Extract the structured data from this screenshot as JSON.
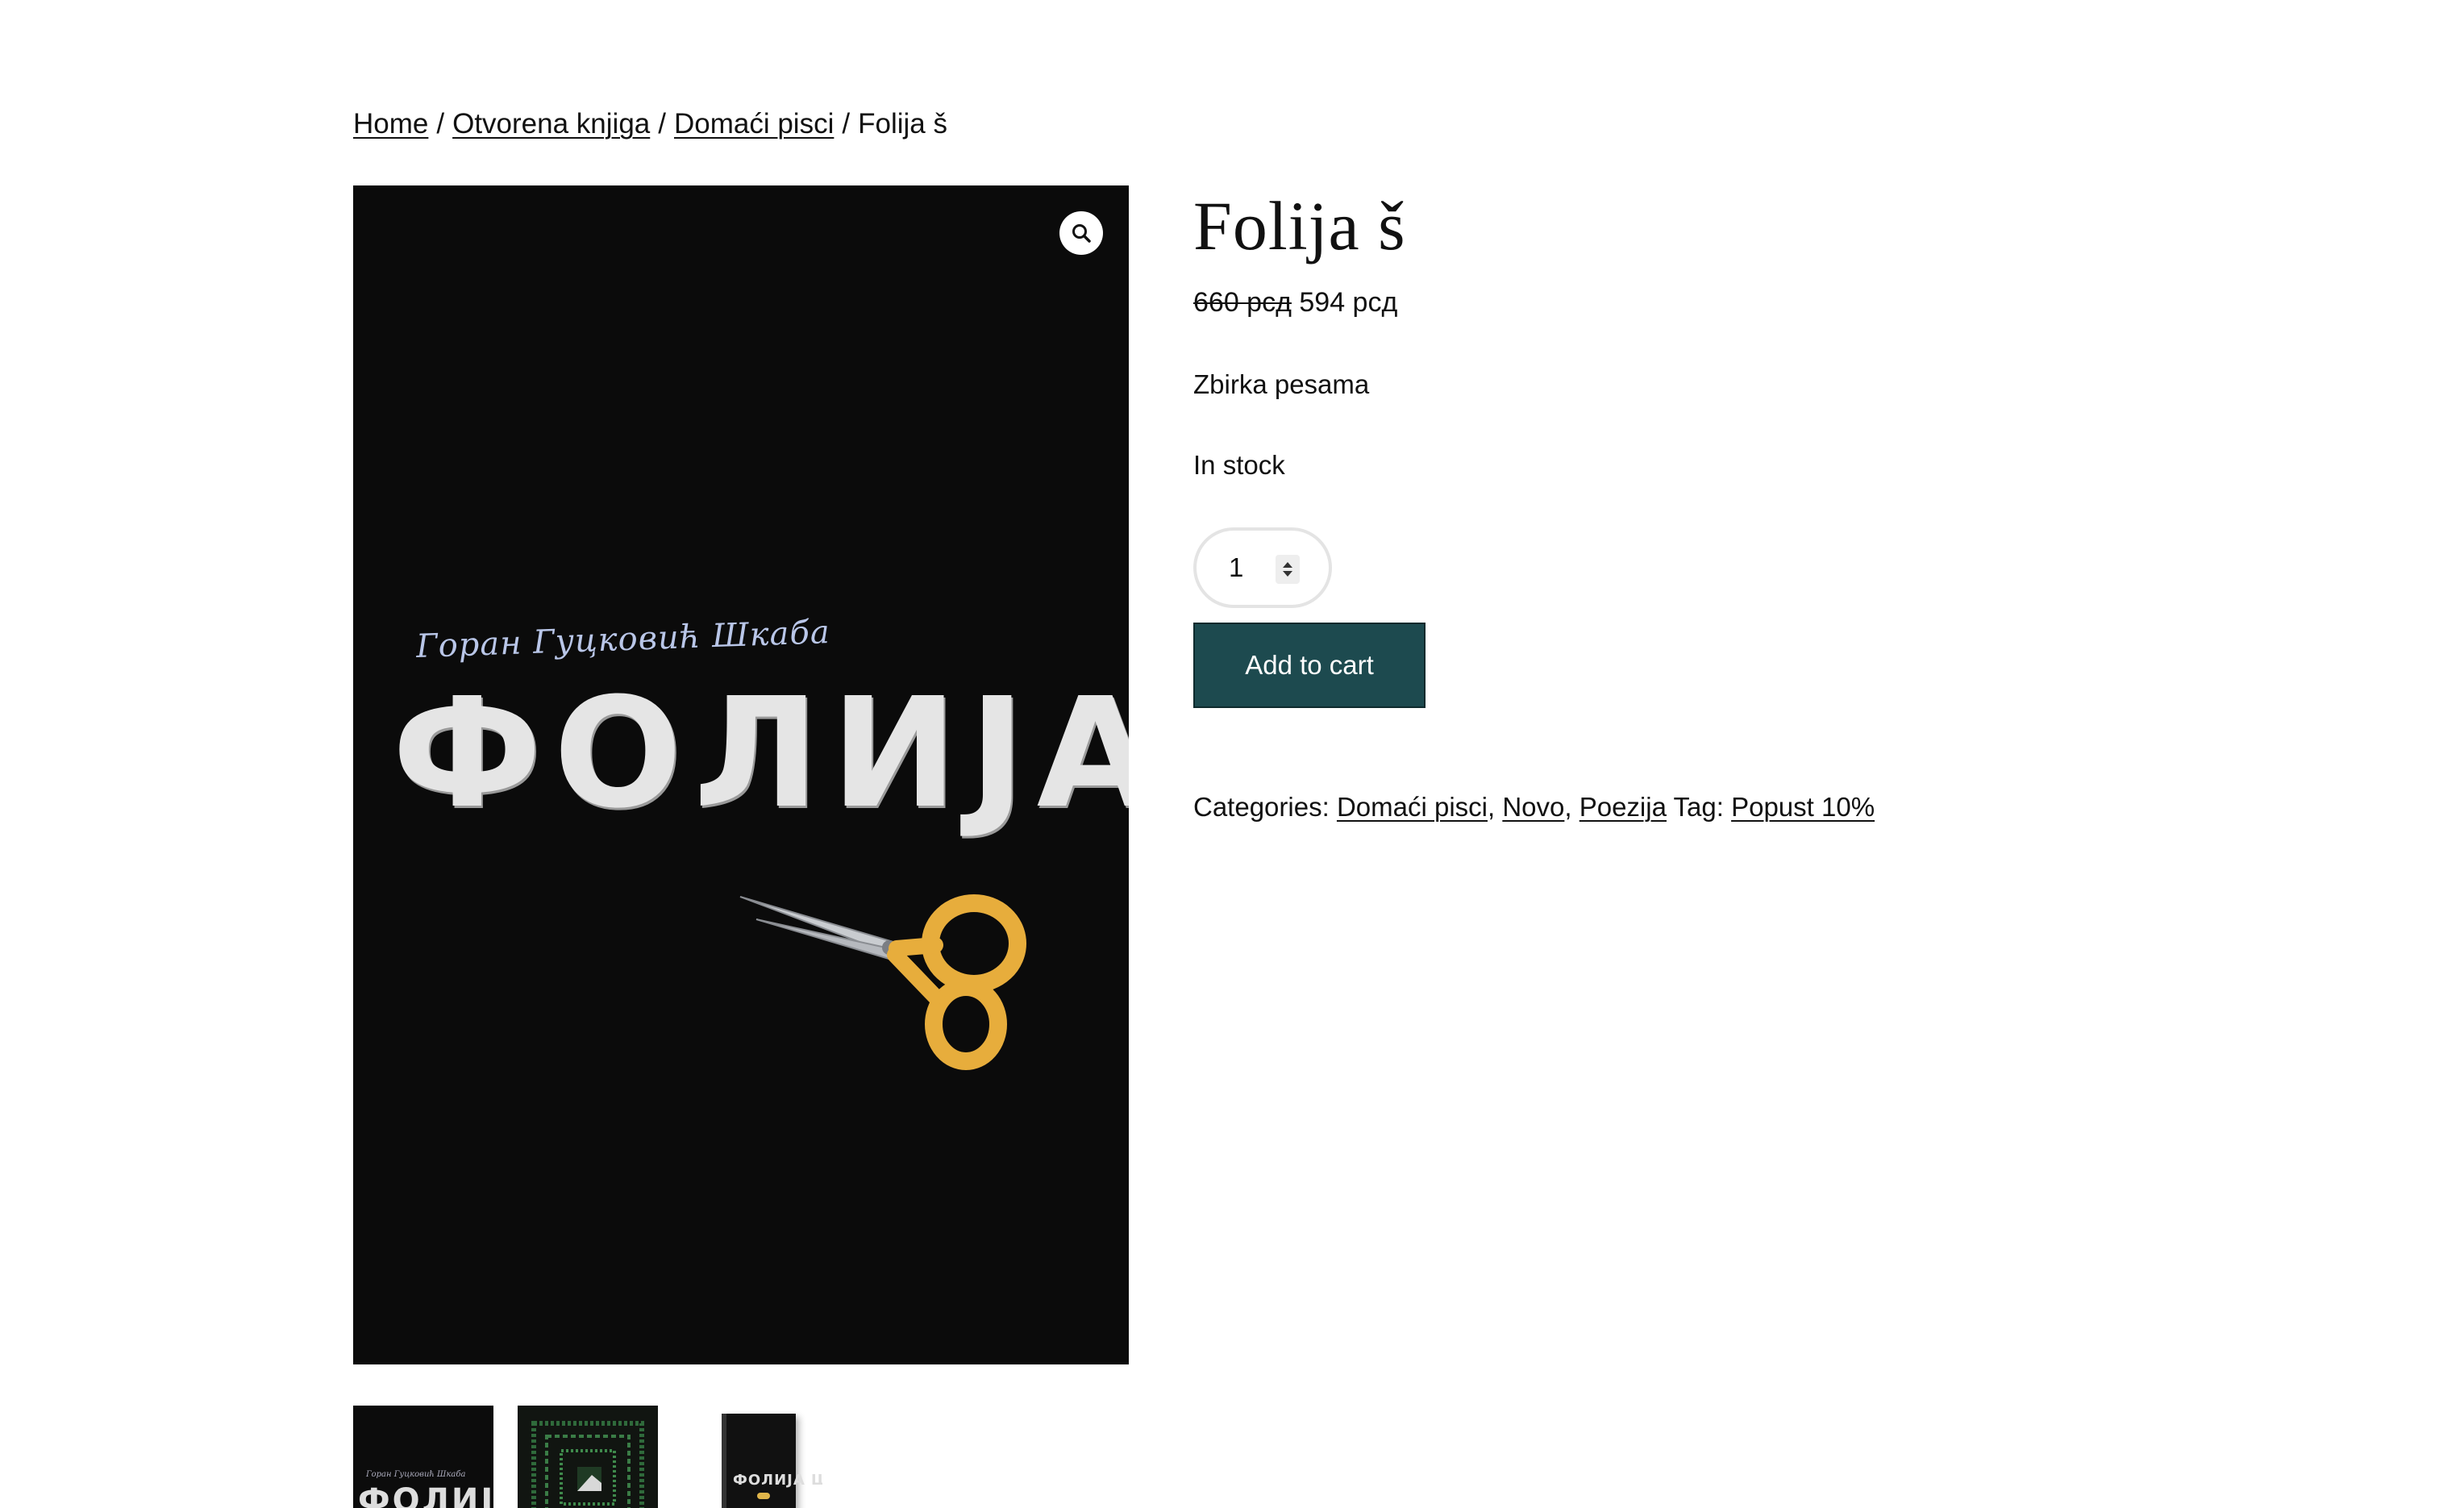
{
  "breadcrumb": {
    "items": [
      "Home",
      "Otvorena knjiga",
      "Domaći pisci"
    ],
    "separator": "/",
    "current": "Folija š"
  },
  "gallery": {
    "zoom_icon": "search-icon",
    "cover_title": "ФОЛИЈА Ш",
    "cover_author": "Горан Гуцковић Шкаба"
  },
  "product": {
    "title": "Folija š",
    "regular_price": "660 рсд",
    "sale_price": "594 рсд",
    "short_description": "Zbirka pesama",
    "stock": "In stock",
    "quantity": "1",
    "add_to_cart_label": "Add to cart"
  },
  "meta": {
    "categories_label": "Categories:",
    "categories": [
      "Domaći pisci",
      "Novo",
      "Poezija"
    ],
    "tag_label": "Tag:",
    "tags": [
      "Popust 10%"
    ]
  },
  "colors": {
    "button_bg": "#1d4a4f",
    "cover_bg": "#0b0b0b",
    "scissors_handle": "#e7ad3c"
  }
}
